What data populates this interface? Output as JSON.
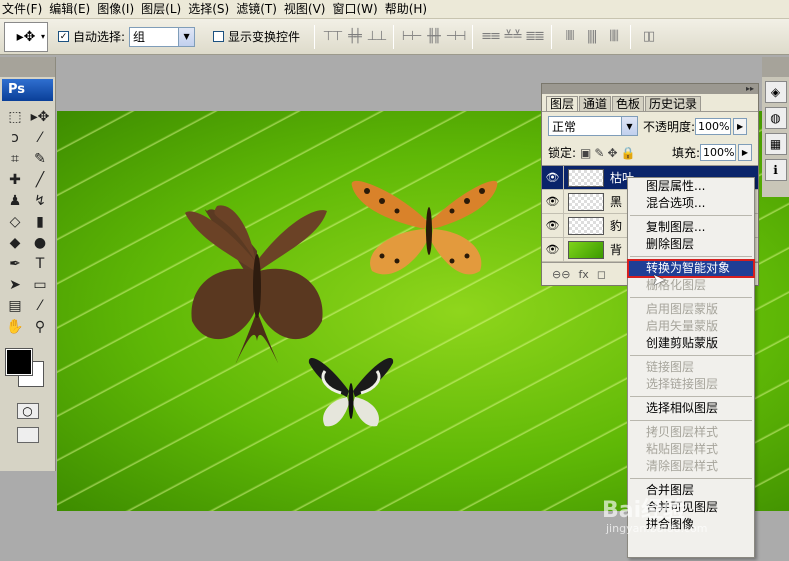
{
  "menubar": {
    "items": [
      "文件(F)",
      "编辑(E)",
      "图像(I)",
      "图层(L)",
      "选择(S)",
      "滤镜(T)",
      "视图(V)",
      "窗口(W)",
      "帮助(H)"
    ]
  },
  "options": {
    "auto_select_label": "自动选择:",
    "auto_select_checked": true,
    "auto_select_value": "组",
    "show_transform_label": "显示变换控件",
    "show_transform_checked": false
  },
  "toolbox": {
    "logo": "Ps",
    "tools": [
      "rect-marquee-icon",
      "move-icon",
      "lasso-icon",
      "magic-wand-icon",
      "crop-icon",
      "slice-icon",
      "healing-brush-icon",
      "brush-icon",
      "clone-stamp-icon",
      "history-brush-icon",
      "eraser-icon",
      "gradient-icon",
      "blur-icon",
      "dodge-icon",
      "pen-icon",
      "type-icon",
      "path-select-icon",
      "shape-icon",
      "notes-icon",
      "eyedropper-icon",
      "hand-icon",
      "zoom-icon"
    ],
    "foreground_color": "#000000",
    "background_color": "#ffffff"
  },
  "layers_panel": {
    "tabs": [
      "图层",
      "通道",
      "色板",
      "历史记录"
    ],
    "blend_mode": "正常",
    "opacity_label": "不透明度:",
    "opacity_value": "100%",
    "lock_label": "锁定:",
    "fill_label": "填充:",
    "fill_value": "100%",
    "layers": [
      {
        "name": "枯叶",
        "selected": true
      },
      {
        "name": "黑",
        "selected": false
      },
      {
        "name": "豹",
        "selected": false
      },
      {
        "name": "背",
        "selected": false
      }
    ],
    "footer": [
      "fx"
    ]
  },
  "context_menu": {
    "items": [
      {
        "label": "图层属性...",
        "enabled": true
      },
      {
        "label": "混合选项...",
        "enabled": true
      },
      {
        "sep": true
      },
      {
        "label": "复制图层...",
        "enabled": true
      },
      {
        "label": "删除图层",
        "enabled": true
      },
      {
        "sep": true
      },
      {
        "label": "转换为智能对象",
        "enabled": true,
        "highlighted": true
      },
      {
        "label": "栅格化图层",
        "enabled": false
      },
      {
        "sep": true
      },
      {
        "label": "启用图层蒙版",
        "enabled": false
      },
      {
        "label": "启用矢量蒙版",
        "enabled": false
      },
      {
        "label": "创建剪贴蒙版",
        "enabled": true
      },
      {
        "sep": true
      },
      {
        "label": "链接图层",
        "enabled": false
      },
      {
        "label": "选择链接图层",
        "enabled": false
      },
      {
        "sep": true
      },
      {
        "label": "选择相似图层",
        "enabled": true
      },
      {
        "sep": true
      },
      {
        "label": "拷贝图层样式",
        "enabled": false
      },
      {
        "label": "粘贴图层样式",
        "enabled": false
      },
      {
        "label": "清除图层样式",
        "enabled": false
      },
      {
        "sep": true
      },
      {
        "label": "合并图层",
        "enabled": true
      },
      {
        "label": "合并可见图层",
        "enabled": true
      },
      {
        "label": "拼合图像",
        "enabled": true
      }
    ]
  },
  "watermark": {
    "text": "Bai经验",
    "sub": "jingyan.baidu.com"
  }
}
